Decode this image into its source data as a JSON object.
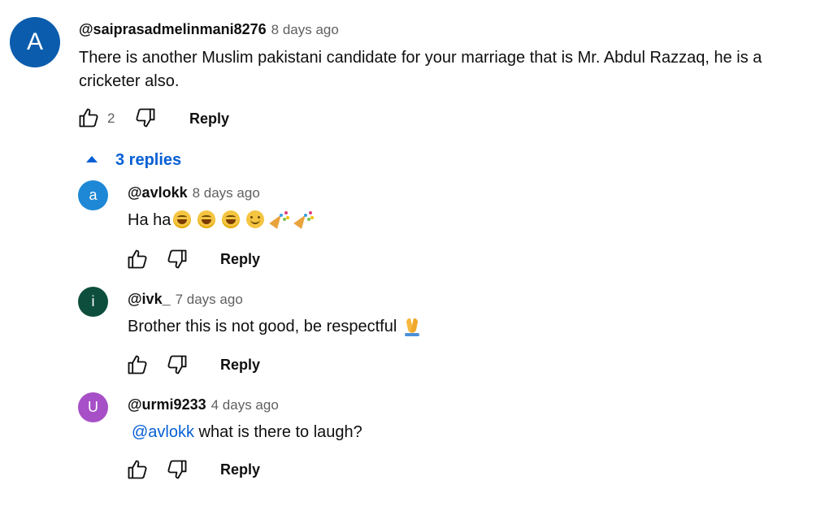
{
  "colors": {
    "link_blue": "#065fd4",
    "avatar_main": "#0b5cad",
    "avatar_a": "#1e88d6",
    "avatar_i": "#0d4f3c",
    "avatar_u": "#a64fc6"
  },
  "comment": {
    "avatar_letter": "A",
    "author": "@saiprasadmelinmani8276",
    "time": "8 days ago",
    "text_line1": "There is another Muslim pakistani candidate for your marriage that is Mr. Abdul Razzaq, he is a",
    "text_line2": "cricketer also.",
    "like_count": "2",
    "reply_label": "Reply",
    "like_icon": "thumbs-up-icon",
    "dislike_icon": "thumbs-down-icon"
  },
  "replies_toggle": {
    "label": "3 replies",
    "icon": "caret-up-icon"
  },
  "replies": [
    {
      "avatar_letter": "a",
      "author": "@avlokk",
      "time": "8 days ago",
      "text": "Ha ha",
      "emojis": [
        "face-with-tears-of-joy",
        "face-with-tears-of-joy",
        "face-with-tears-of-joy",
        "smiling-face",
        "party-popper",
        "party-popper"
      ],
      "reply_label": "Reply"
    },
    {
      "avatar_letter": "i",
      "author": "@ivk_",
      "time": "7 days ago",
      "text": "Brother this is not good, be respectful",
      "emojis": [
        "folded-hands"
      ],
      "reply_label": "Reply"
    },
    {
      "avatar_letter": "U",
      "author": "@urmi9233",
      "time": "4 days ago",
      "mention": "@avlokk",
      "text": " what is there to laugh?",
      "reply_label": "Reply"
    }
  ]
}
